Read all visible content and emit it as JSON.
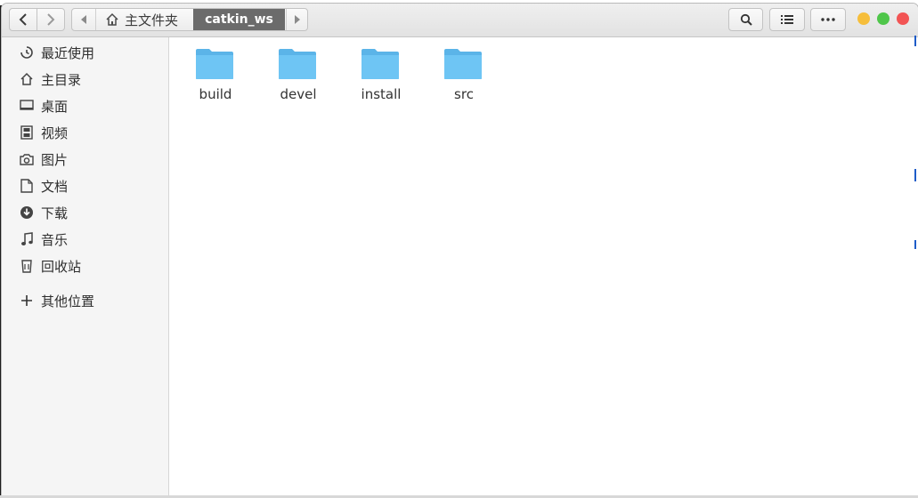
{
  "header": {
    "path_home_label": "主文件夹",
    "path_current_label": "catkin_ws"
  },
  "sidebar": {
    "items": [
      {
        "label": "最近使用",
        "icon": "recent-icon"
      },
      {
        "label": "主目录",
        "icon": "home-icon"
      },
      {
        "label": "桌面",
        "icon": "desktop-icon"
      },
      {
        "label": "视频",
        "icon": "video-icon"
      },
      {
        "label": "图片",
        "icon": "camera-icon"
      },
      {
        "label": "文档",
        "icon": "document-icon"
      },
      {
        "label": "下载",
        "icon": "download-icon"
      },
      {
        "label": "音乐",
        "icon": "music-icon"
      },
      {
        "label": "回收站",
        "icon": "trash-icon"
      }
    ],
    "other_locations": "其他位置"
  },
  "files": [
    {
      "name": "build"
    },
    {
      "name": "devel"
    },
    {
      "name": "install"
    },
    {
      "name": "src"
    }
  ],
  "colors": {
    "folder": "#6ec5f4",
    "folder_tab": "#5bb4e8",
    "path_active": "#6b6b6b",
    "close": "#f25454",
    "minimize": "#f6be3b",
    "maximize": "#4fc64a"
  }
}
